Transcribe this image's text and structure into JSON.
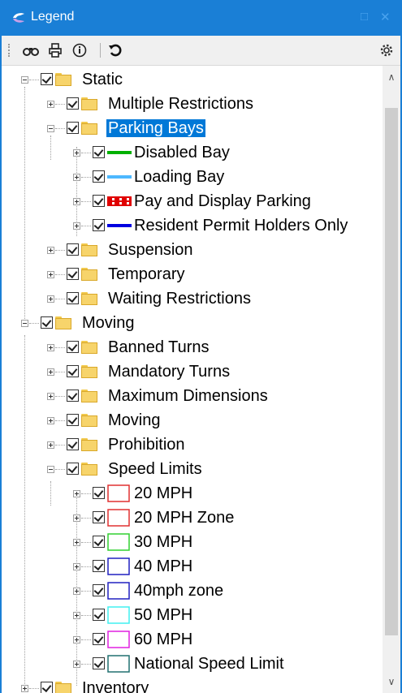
{
  "window": {
    "title": "Legend",
    "minimize_glyph": "□",
    "close_glyph": "✕"
  },
  "toolbar": {
    "find_icon": "binoculars-icon",
    "print_icon": "print-icon",
    "info_icon": "info-icon",
    "refresh_icon": "refresh-icon",
    "settings_icon": "gear-icon"
  },
  "tree": {
    "static": {
      "label": "Static",
      "children": {
        "multiple_restrictions": "Multiple Restrictions",
        "parking_bays": {
          "label": "Parking Bays",
          "selected": true,
          "items": {
            "disabled_bay": "Disabled Bay",
            "loading_bay": "Loading Bay",
            "pay_and_display": "Pay and Display Parking",
            "resident_permit": "Resident Permit Holders Only"
          }
        },
        "suspension": "Suspension",
        "temporary": "Temporary",
        "waiting_restrictions": "Waiting Restrictions"
      }
    },
    "moving": {
      "label": "Moving",
      "children": {
        "banned_turns": "Banned Turns",
        "mandatory_turns": "Mandatory Turns",
        "maximum_dimensions": "Maximum Dimensions",
        "moving": "Moving",
        "prohibition": "Prohibition",
        "speed_limits": {
          "label": "Speed Limits",
          "items": {
            "mph20": "20 MPH",
            "mph20_zone": "20 MPH Zone",
            "mph30": "30 MPH",
            "mph40": "40 MPH",
            "mph40_zone": "40mph zone",
            "mph50": "50 MPH",
            "mph60": "60 MPH",
            "national": "National Speed Limit"
          }
        }
      }
    },
    "inventory": {
      "label": "Inventory"
    }
  },
  "colors": {
    "titlebar": "#1a7fd6",
    "disabled_bay": "#00b000",
    "loading_bay": "#4db8ff",
    "pay_and_display": "#e00000",
    "resident_permit": "#0000e0",
    "mph20": "#e03030",
    "mph20_zone": "#e03030",
    "mph30": "#30d030",
    "mph40": "#2020c0",
    "mph40_zone": "#2020c0",
    "mph50": "#40f0f0",
    "mph60": "#e020e0",
    "national": "#207070"
  }
}
